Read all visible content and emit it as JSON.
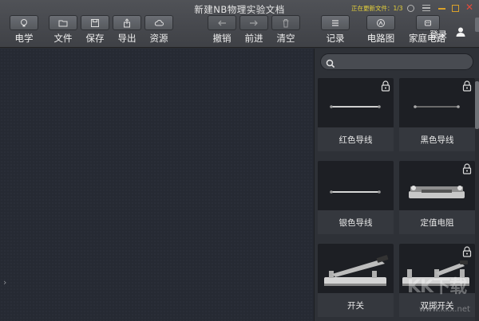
{
  "window": {
    "title": "新建NB物理实验文档",
    "update_status": "正在更新文件：1/3"
  },
  "toolbar": {
    "electric": "电学",
    "file": "文件",
    "save": "保存",
    "export": "导出",
    "resources": "资源",
    "undo": "撤销",
    "redo": "前进",
    "clear": "清空",
    "record": "记录",
    "circuit_diagram": "电路图",
    "home_circuit": "家庭电路",
    "login": "登录"
  },
  "search": {
    "placeholder": ""
  },
  "components": [
    {
      "label": "红色导线",
      "locked": true,
      "wire_color": "#d9d9d9"
    },
    {
      "label": "黑色导线",
      "locked": true,
      "wire_color": "#555555"
    },
    {
      "label": "银色导线",
      "locked": false,
      "wire_color": "#cfcfcf"
    },
    {
      "label": "定值电阻",
      "locked": true
    },
    {
      "label": "开关",
      "locked": false
    },
    {
      "label": "双掷开关",
      "locked": true
    }
  ],
  "watermark": {
    "logo_text": "KK下载",
    "url": "www.kkx.net"
  }
}
